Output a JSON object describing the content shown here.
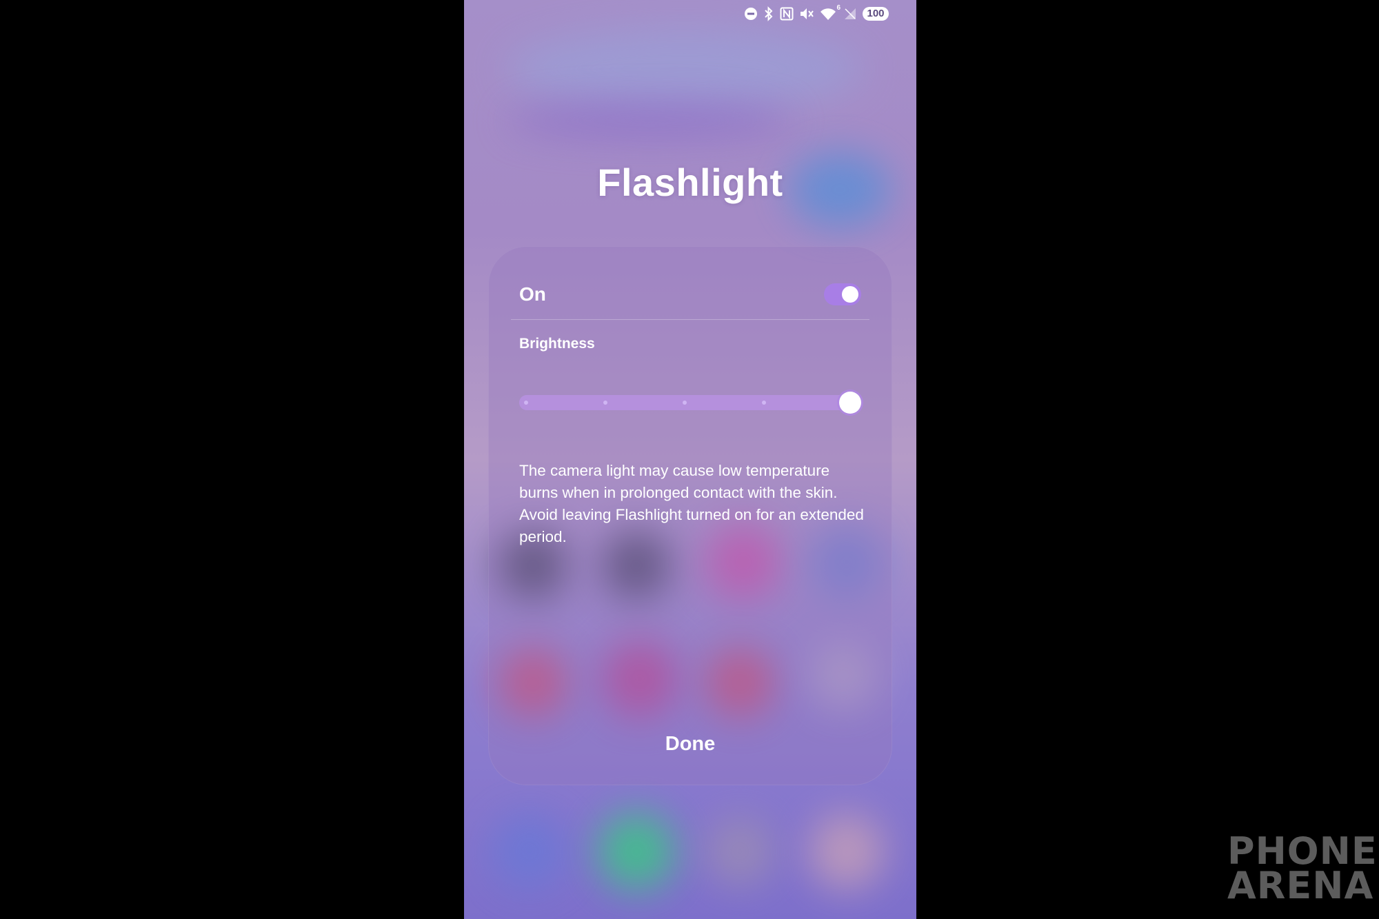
{
  "status_bar": {
    "icons": [
      "do-not-disturb-icon",
      "bluetooth-icon",
      "nfc-icon",
      "mute-icon",
      "wifi-icon",
      "no-signal-icon"
    ],
    "wifi_badge": "6",
    "battery": "100"
  },
  "dialog": {
    "title": "Flashlight",
    "on_label": "On",
    "toggle_on": true,
    "brightness_label": "Brightness",
    "brightness_level": 5,
    "brightness_max": 5,
    "warning_text": "The camera light may cause low temperature burns when in prolonged contact with the skin. Avoid leaving Flashlight turned on for an extended period.",
    "done_label": "Done"
  },
  "watermark": {
    "line1": "PHONE",
    "line2": "ARENA"
  },
  "colors": {
    "accent": "#a87ee6",
    "toggle_knob": "#ffffff",
    "text": "#ffffff"
  }
}
